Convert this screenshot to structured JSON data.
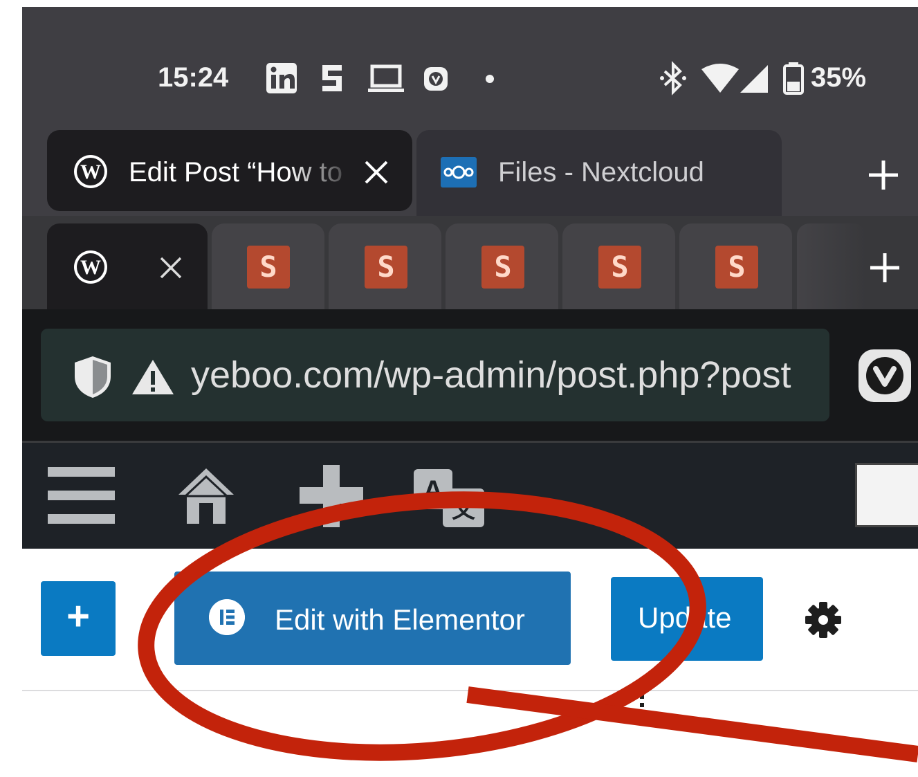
{
  "status_bar": {
    "time": "15:24",
    "notification_icons": [
      "linkedin-icon",
      "stack-s-icon",
      "laptop-icon",
      "vivaldi-icon",
      "dot-icon"
    ],
    "system_icons": [
      "bluetooth-icon",
      "wifi-icon",
      "signal-icon",
      "battery-icon"
    ],
    "battery": "35%"
  },
  "tabs": [
    {
      "title": "Edit Post “How to",
      "icon": "wordpress-icon",
      "active": true
    },
    {
      "title": "Files - Nextcloud",
      "icon": "nextcloud-icon",
      "active": false
    }
  ],
  "tab_stack": {
    "items": [
      "wordpress-icon",
      "S",
      "S",
      "S",
      "S",
      "S"
    ]
  },
  "address_bar": {
    "url": "yeboo.com/wp-admin/post.php?post",
    "security_warning": "warning-icon"
  },
  "wp_admin_bar": {
    "icons": [
      "menu-icon",
      "home-icon",
      "new-content-icon",
      "translate-icon"
    ]
  },
  "editor_toolbar": {
    "add_block_label": "+",
    "elementor_label": "Edit with Elementor",
    "update_label": "Update"
  },
  "colors": {
    "wp_blue": "#0a7ac2",
    "elementor_blue": "#2072b1",
    "annotation_red": "#c3230b",
    "s_badge": "#b4492f"
  }
}
